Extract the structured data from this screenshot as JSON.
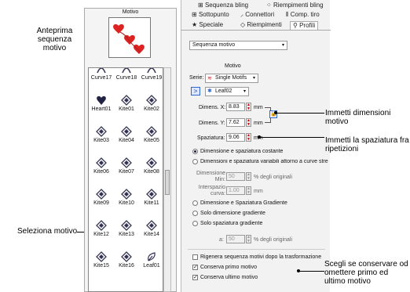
{
  "annotations": {
    "preview_label": "Anteprima sequenza motivo",
    "select_label": "Seleziona motivo",
    "dims_label": "Immetti dimensioni motivo",
    "spacing_label": "Immetti la spaziatura fra ripetizioni",
    "keep_label": "Scegli se conservare od omettere primo ed ultimo motivo"
  },
  "motif_panel": {
    "title": "Motivo",
    "items": [
      {
        "label": "Curve17",
        "icon": "curve-motif-icon"
      },
      {
        "label": "Curve18",
        "icon": "curve-motif-icon"
      },
      {
        "label": "Curve19",
        "icon": "curve-motif-icon"
      },
      {
        "label": "Heart01",
        "icon": "heart-motif-icon"
      },
      {
        "label": "Kite01",
        "icon": "kite-motif-icon"
      },
      {
        "label": "Kite02",
        "icon": "kite-motif-icon"
      },
      {
        "label": "Kite03",
        "icon": "kite-motif-icon"
      },
      {
        "label": "Kite04",
        "icon": "kite-motif-icon"
      },
      {
        "label": "Kite05",
        "icon": "kite-motif-icon"
      },
      {
        "label": "Kite06",
        "icon": "kite-motif-icon"
      },
      {
        "label": "Kite07",
        "icon": "kite-motif-icon"
      },
      {
        "label": "Kite08",
        "icon": "kite-motif-icon"
      },
      {
        "label": "Kite09",
        "icon": "kite-motif-icon"
      },
      {
        "label": "Kite10",
        "icon": "kite-motif-icon"
      },
      {
        "label": "Kite11",
        "icon": "kite-motif-icon"
      },
      {
        "label": "Kite12",
        "icon": "kite-motif-icon"
      },
      {
        "label": "Kite13",
        "icon": "kite-motif-icon"
      },
      {
        "label": "Kite14",
        "icon": "kite-motif-icon"
      },
      {
        "label": "Kite15",
        "icon": "kite-motif-icon"
      },
      {
        "label": "Kite16",
        "icon": "kite-motif-icon"
      },
      {
        "label": "Leaf01",
        "icon": "leaf-motif-icon"
      }
    ]
  },
  "tabs": {
    "row1": [
      "Sequenza bling",
      "Riempimenti bling"
    ],
    "row2": [
      "Sottopunto",
      "Connettori",
      "Comp. tiro"
    ],
    "row3": [
      "Speciale",
      "Riempimenti",
      "Profili"
    ]
  },
  "profile": {
    "type_value": "Sequenza motivo",
    "group_title": "Motivo",
    "series_label": "Serie:",
    "series_value": "Single Motifs",
    "motif_value": "Leaf02",
    "next_button": ">",
    "dim_x_label": "Dimens. X:",
    "dim_x_value": "8.83",
    "dim_y_label": "Dimens. Y:",
    "dim_y_value": "7.62",
    "spacing_label": "Spaziatura:",
    "spacing_value": "9.06",
    "unit": "mm",
    "opt_const": "Dimensione e spaziatura costante",
    "opt_variable": "Dimensioni e spaziatura variabili attorno a curve stre",
    "min_size_label": "Dimensione Min:",
    "min_size_value": "50",
    "percent_orig": "% degli originali",
    "curve_spacing_label": "Interspazio curva:",
    "curve_spacing_value": "1.00",
    "opt_gradient": "Dimensione e Spaziatura Gradiente",
    "opt_size_gradient": "Solo dimensione gradiente",
    "opt_spacing_gradient": "Solo spaziatura gradiente",
    "a_label": "a:",
    "a_value": "50",
    "chk_regen": "Rigenera sequenza motivi dopo la trasformazione",
    "chk_first": "Conserva primo motivo",
    "chk_last": "Conserva ultimo motivo"
  }
}
